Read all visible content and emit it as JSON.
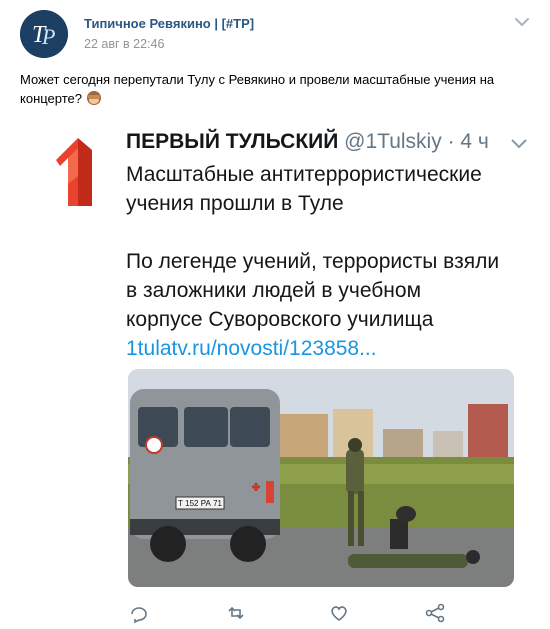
{
  "post": {
    "author": "Типичное Ревякино | [#ТР]",
    "date": "22 авг в 22:46",
    "text": "Может сегодня перепутали Тулу с Ревякино и провели масштабные учения на концерте?",
    "emoji_icon": "see-no-evil-monkey-icon"
  },
  "tweet": {
    "name": "ПЕРВЫЙ ТУЛЬСКИЙ",
    "handle": "@1Tulskiy",
    "time": "· 4 ч",
    "line1": "Масштабные антитеррористические",
    "line2": "учения прошли в Туле",
    "line3": "По легенде учений, террористы взяли",
    "line4": "в заложники людей в учебном",
    "line5": "корпусе Суворовского училища",
    "link": "1tulatv.ru/novosti/123858...",
    "plate": "Т 152 РА 71"
  },
  "colors": {
    "link_blue": "#2a5885",
    "twitter_blue": "#1b95e0",
    "logo_red": "#e8432e"
  }
}
